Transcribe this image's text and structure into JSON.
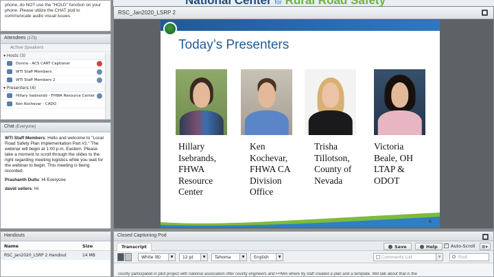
{
  "banner": {
    "brand_prefix": "National Center",
    "brand_for": "for",
    "brand_suffix": "Rural Road Safety"
  },
  "top_message": "phone, do NOT use the \"HOLD\" function on your phone. Please utilize the CHAT pod to communicate audio visual issues.",
  "attendees": {
    "title": "Attendees",
    "count": "(173)",
    "subheader": "Active Speakers",
    "hosts_label": "Hosts (3)",
    "hosts": [
      {
        "name": "Donna - ACS CART Captioner"
      },
      {
        "name": "WTI Staff Members"
      },
      {
        "name": "WTI Staff Members 2"
      }
    ],
    "presenters_label": "Presenters (4)",
    "presenters": [
      {
        "name": "Hillary Isebrands - FHWA Resource Center"
      },
      {
        "name": "Ken Kochevar - CADO"
      }
    ]
  },
  "chat": {
    "title": "Chat",
    "scope": "(Everyone)",
    "messages": [
      {
        "sender": "WTI Staff Members",
        "text": ": Hello and welcome to \"Local Road Safety Plan Implementation Part #2.\" The webinar will begin at 1:00 p.m. Eastern. Please take a moment to scroll through the slides to the right regarding meeting logistics while you wait for the webinar to begin. This meeting is being recorded."
      },
      {
        "sender": "Prashanth Dullu",
        "text": ": Hi Everyone"
      },
      {
        "sender": "david sellers",
        "text": ": Hi"
      }
    ]
  },
  "handouts": {
    "title": "Handouts",
    "col_name": "Name",
    "col_size": "Size",
    "files": [
      {
        "name": "RSC_Jan2020_LSRP 2 Handout",
        "size": "14 MB"
      }
    ]
  },
  "share": {
    "title": "RSC_Jan2020_LSRP 2",
    "slide": {
      "title": "Today’s Presenters",
      "page_number": "6",
      "presenters": [
        {
          "name_lines": [
            "Hillary",
            "Isebrands,",
            "FHWA",
            "Resource",
            "Center"
          ]
        },
        {
          "name_lines": [
            "Ken",
            "Kochevar,",
            "FHWA CA",
            "Division",
            "Office"
          ]
        },
        {
          "name_lines": [
            "Trisha",
            "Tillotson,",
            "County of",
            "Nevada"
          ]
        },
        {
          "name_lines": [
            "Victoria",
            "Beale, OH",
            "LTAP &",
            "ODOT"
          ]
        }
      ]
    }
  },
  "captioning": {
    "title": "Closed Captioning Pod",
    "tab": "Transcript",
    "save_label": "Save",
    "help_label": "Help",
    "autoscroll_label": "Auto-Scroll",
    "autoscroll_checked": true,
    "color_value": "White (B)",
    "size_value": "12 pt",
    "font_value": "Tahoma",
    "language_value": "English",
    "comments_label": "Comments List",
    "find_placeholder": "Find",
    "transcript_line": "county participated in pilot project with national association offer county engineers and FHWA where by staff created a plan and a template. Will talk about that in the"
  }
}
